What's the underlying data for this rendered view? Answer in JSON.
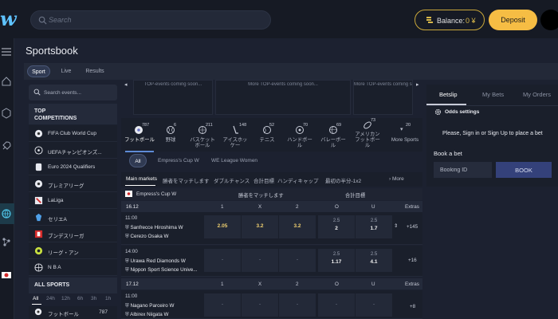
{
  "header": {
    "logo": "w",
    "search_placeholder": "Search",
    "balance_label": "Balance:",
    "balance_value": "0 ¥",
    "deposit_label": "Deposit"
  },
  "page": {
    "title": "Sportsbook",
    "tabs": [
      {
        "label": "Sport",
        "active": true
      },
      {
        "label": "Live",
        "active": false
      },
      {
        "label": "Results",
        "active": false
      }
    ]
  },
  "left_panel": {
    "search_placeholder": "Search events...",
    "top_competitions_title": "TOP\nCOMPETITIONS",
    "top_competitions_line1": "TOP",
    "top_competitions_line2": "COMPETITIONS",
    "competitions": [
      {
        "label": "FIFA Club World Cup",
        "icon": "soccer-ball-icon"
      },
      {
        "label": "UEFAチャンピオンズ...",
        "icon": "uefa-icon"
      },
      {
        "label": "Euro 2024 Qualifiers",
        "icon": "euro-icon"
      },
      {
        "label": "プレミアリーグ",
        "icon": "soccer-ball-icon"
      },
      {
        "label": "LaLiga",
        "icon": "laliga-icon"
      },
      {
        "label": "セリエA",
        "icon": "seriea-icon"
      },
      {
        "label": "ブンデスリーガ",
        "icon": "bundesliga-icon"
      },
      {
        "label": "リーグ・アン",
        "icon": "ligue1-icon"
      },
      {
        "label": "N B A",
        "icon": "basketball-icon"
      }
    ],
    "all_sports_title": "ALL SPORTS",
    "time_filters": [
      "All",
      "24h",
      "12h",
      "6h",
      "3h",
      "1h"
    ],
    "sport_row": {
      "label": "フットボール",
      "count": "787"
    }
  },
  "top_events": [
    "TOP-events coming soon...",
    "More TOP-events coming soon...",
    "More TOP-events coming soon..."
  ],
  "sports": [
    {
      "label": "フットボール",
      "count": "787",
      "active": true,
      "icon": "soccer-ball-icon"
    },
    {
      "label": "野球",
      "count": "6",
      "active": false,
      "icon": "baseball-icon"
    },
    {
      "label": "バスケット\nボール",
      "line1": "バスケット",
      "line2": "ボール",
      "count": "211",
      "active": false,
      "icon": "basketball-icon"
    },
    {
      "label": "アイスホッ\nケー",
      "line1": "アイスホッ",
      "line2": "ケー",
      "count": "148",
      "active": false,
      "icon": "hockey-icon"
    },
    {
      "label": "テニス",
      "count": "52",
      "active": false,
      "icon": "tennis-icon"
    },
    {
      "label": "ハンドボー\nル",
      "line1": "ハンドボー",
      "line2": "ル",
      "count": "70",
      "active": false,
      "icon": "handball-icon"
    },
    {
      "label": "バレーボー\nル",
      "line1": "バレーボー",
      "line2": "ル",
      "count": "69",
      "active": false,
      "icon": "volleyball-icon"
    },
    {
      "label": "アメリカン\nフットボー\nル",
      "line1": "アメリカン",
      "line2": "フットボー",
      "line3": "ル",
      "count": "73",
      "active": false,
      "icon": "american-football-icon"
    },
    {
      "label": "More Sports",
      "count": "20",
      "active": false,
      "icon": "chevron-down-icon"
    }
  ],
  "league_filters": [
    {
      "label": "All",
      "active": true
    },
    {
      "label": "Empress's Cup W",
      "active": false
    },
    {
      "label": "WE League Women",
      "active": false
    }
  ],
  "markets": [
    {
      "label": "Main markets",
      "active": true
    },
    {
      "label": "勝者をマッチします",
      "active": false
    },
    {
      "label": "ダブルチャンス",
      "active": false
    },
    {
      "label": "合計目標",
      "active": false
    },
    {
      "label": "ハンディキャップ",
      "active": false
    },
    {
      "label": "最初の半分-1x2",
      "active": false
    }
  ],
  "more_label": "More",
  "table": {
    "league": "Empress's Cup W",
    "col_winner": "勝者をマッチします",
    "col_total": "合計目標",
    "date_groups": [
      {
        "date": "16.12",
        "headers": [
          "1",
          "X",
          "2",
          "O",
          "U",
          "Extras"
        ],
        "matches": [
          {
            "time": "11:00",
            "home": "Sanfrecce Hiroshima W",
            "away": "Cerezo Osaka W",
            "o1": "2.05",
            "ox": "3.2",
            "o2": "3.2",
            "over_line": "2.5",
            "over": "2",
            "under_line": "2.5",
            "under": "1.7",
            "extras": "+145"
          },
          {
            "time": "14:00",
            "home": "Urawa Red Diamonds W",
            "away": "Nippon Sport Science Unive...",
            "o1": "-",
            "ox": "-",
            "o2": "-",
            "over_line": "2.5",
            "over": "1.17",
            "under_line": "2.5",
            "under": "4.1",
            "extras": "+16"
          }
        ]
      },
      {
        "date": "17.12",
        "headers": [
          "1",
          "X",
          "2",
          "O",
          "U",
          "Extras"
        ],
        "matches": [
          {
            "time": "11:00",
            "home": "Nagano Parceiro W",
            "away": "Albirex Niigata W",
            "o1": "-",
            "ox": "-",
            "o2": "-",
            "over_line": "-",
            "over": "",
            "under_line": "-",
            "under": "",
            "extras": "+8"
          }
        ]
      }
    ]
  },
  "betslip": {
    "tabs": [
      "Betslip",
      "My Bets",
      "My Orders"
    ],
    "odds_settings": "Odds settings",
    "signin_msg": "Please, Sign in or Sign Up to place a bet",
    "book_label": "Book a bet",
    "booking_placeholder": "Booking ID",
    "book_button": "BOOK"
  },
  "colors": {
    "accent": "#f6bd44",
    "balance_border": "#c9a73a",
    "book_button": "#34417a",
    "odds_highlight": "#f0d070"
  }
}
